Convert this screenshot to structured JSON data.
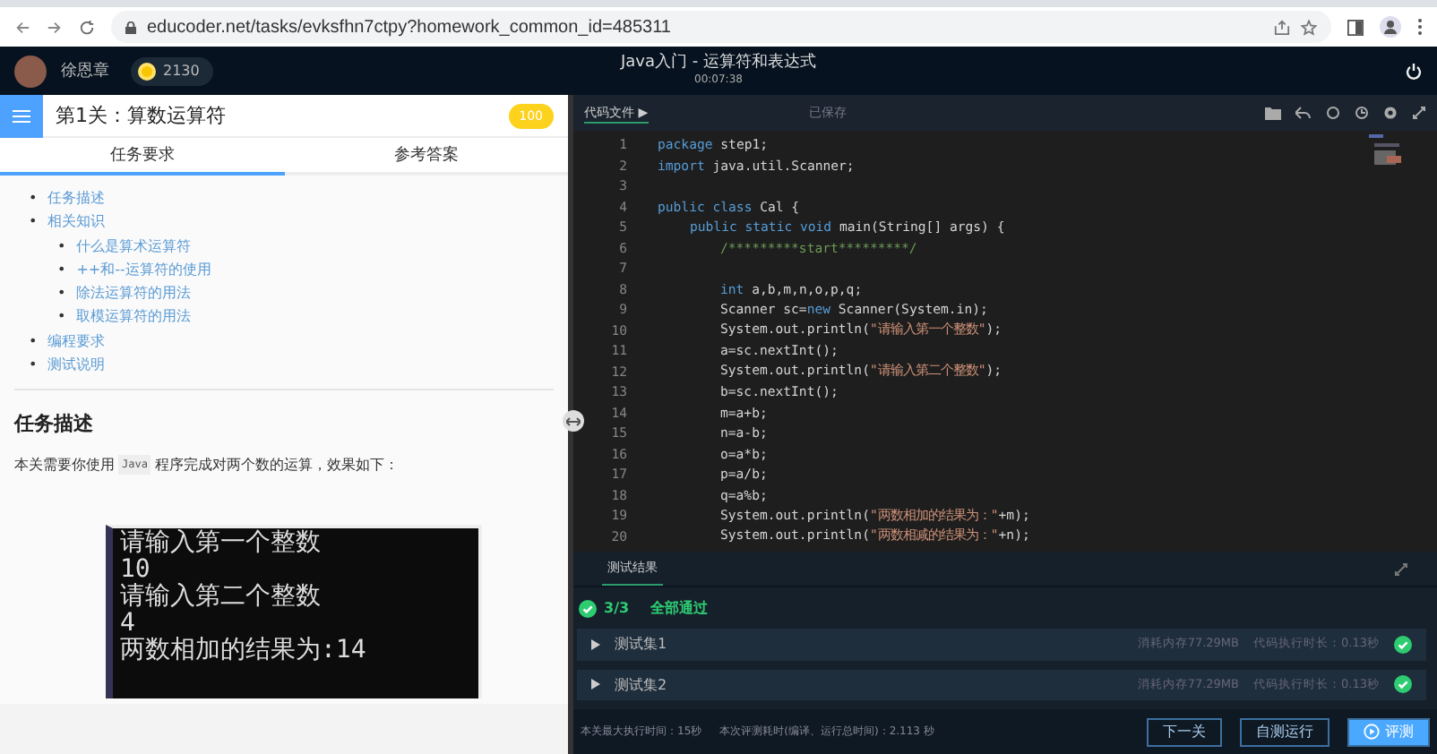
{
  "browser": {
    "url": "educoder.net/tasks/evksfhn7ctpy?homework_common_id=485311"
  },
  "header": {
    "user": "徐恩章",
    "coins": "2130",
    "title": "Java入门 - 运算符和表达式",
    "timer": "00:07:38"
  },
  "task": {
    "title": "第1关：算数运算符",
    "score": "100",
    "tabs": [
      {
        "label": "任务要求",
        "selected": true
      },
      {
        "label": "参考答案",
        "selected": false
      }
    ],
    "toc": [
      {
        "marker": "•",
        "label": "任务描述"
      },
      {
        "marker": "•",
        "label": "相关知识",
        "children": [
          {
            "marker": "•",
            "label": "什么是算术运算符"
          },
          {
            "marker": "•",
            "label": "++和--运算符的使用"
          },
          {
            "marker": "•",
            "label": "除法运算符的用法"
          },
          {
            "marker": "•",
            "label": "取模运算符的用法"
          }
        ]
      },
      {
        "marker": "•",
        "label": "编程要求"
      },
      {
        "marker": "•",
        "label": "测试说明"
      }
    ],
    "heading": "任务描述",
    "intro_before": "本关需要你使用",
    "intro_code": "Java",
    "intro_after": "程序完成对两个数的运算，效果如下：",
    "console": [
      "请输入第一个整数",
      "10",
      "请输入第二个整数",
      "4",
      "两数相加的结果为:14"
    ]
  },
  "editor": {
    "file_tab": "代码文件 ▶",
    "save_status": "已保存",
    "lines": [
      {
        "number": "1",
        "kind": "top",
        "tokens": [
          {
            "t": "package",
            "kind": "keyword"
          },
          {
            "t": " step1;",
            "kind": "plain"
          }
        ]
      },
      {
        "number": "2",
        "kind": "top",
        "tokens": [
          {
            "t": "import",
            "kind": "keyword"
          },
          {
            "t": " java.util.Scanner;",
            "kind": "plain"
          }
        ]
      },
      {
        "number": "3"
      },
      {
        "number": "4",
        "kind": "top",
        "tokens": [
          {
            "t": "public class",
            "kind": "keyword"
          },
          {
            "t": " Cal {",
            "kind": "plain"
          }
        ]
      },
      {
        "number": "5",
        "kind": "member",
        "tokens": [
          {
            "t": "public static void",
            "kind": "keyword"
          },
          {
            "t": " main(String[] args) {",
            "kind": "plain"
          }
        ]
      },
      {
        "number": "6",
        "kind": "body",
        "tokens": [
          {
            "t": "/*********start*********/",
            "kind": "comment"
          }
        ]
      },
      {
        "number": "7"
      },
      {
        "number": "8",
        "kind": "body",
        "tokens": [
          {
            "t": "int",
            "kind": "keyword"
          },
          {
            "t": " a,b,m,n,o,p,q;",
            "kind": "plain"
          }
        ]
      },
      {
        "number": "9",
        "kind": "body",
        "tokens": [
          {
            "t": "Scanner sc=",
            "kind": "plain"
          },
          {
            "t": "new",
            "kind": "keyword"
          },
          {
            "t": " Scanner(System.in);",
            "kind": "plain"
          }
        ]
      },
      {
        "number": "10",
        "kind": "body",
        "tokens": [
          {
            "t": "System.out.println(",
            "kind": "plain"
          },
          {
            "t": "\"请输入第一个整数\"",
            "kind": "string"
          },
          {
            "t": ");",
            "kind": "plain"
          }
        ]
      },
      {
        "number": "11",
        "kind": "body",
        "tokens": [
          {
            "t": "a=sc.nextInt();",
            "kind": "plain"
          }
        ]
      },
      {
        "number": "12",
        "kind": "body",
        "tokens": [
          {
            "t": "System.out.println(",
            "kind": "plain"
          },
          {
            "t": "\"请输入第二个整数\"",
            "kind": "string"
          },
          {
            "t": ");",
            "kind": "plain"
          }
        ]
      },
      {
        "number": "13",
        "kind": "body",
        "tokens": [
          {
            "t": "b=sc.nextInt();",
            "kind": "plain"
          }
        ]
      },
      {
        "number": "14",
        "kind": "body",
        "tokens": [
          {
            "t": "m=a+b;",
            "kind": "plain"
          }
        ]
      },
      {
        "number": "15",
        "kind": "body",
        "tokens": [
          {
            "t": "n=a-b;",
            "kind": "plain"
          }
        ]
      },
      {
        "number": "16",
        "kind": "body",
        "tokens": [
          {
            "t": "o=a*b;",
            "kind": "plain"
          }
        ]
      },
      {
        "number": "17",
        "kind": "body",
        "tokens": [
          {
            "t": "p=a/b;",
            "kind": "plain"
          }
        ]
      },
      {
        "number": "18",
        "kind": "body",
        "tokens": [
          {
            "t": "q=a%b;",
            "kind": "plain"
          }
        ]
      },
      {
        "number": "19",
        "kind": "body",
        "tokens": [
          {
            "t": "System.out.println(",
            "kind": "plain"
          },
          {
            "t": "\"两数相加的结果为：\"",
            "kind": "string"
          },
          {
            "t": "+m);",
            "kind": "plain"
          }
        ]
      },
      {
        "number": "20",
        "kind": "body",
        "tokens": [
          {
            "t": "System.out.println(",
            "kind": "plain"
          },
          {
            "t": "\"两数相减的结果为：\"",
            "kind": "string"
          },
          {
            "t": "+n);",
            "kind": "plain"
          }
        ]
      }
    ]
  },
  "results": {
    "tab": "测试结果",
    "count": "3/3",
    "summary": "全部通过",
    "cases": [
      {
        "name": "测试集1",
        "memory": "消耗内存77.29MB",
        "time": "代码执行时长：0.13秒",
        "passed": true
      },
      {
        "name": "测试集2",
        "memory": "消耗内存77.29MB",
        "time": "代码执行时长：0.13秒",
        "passed": true
      }
    ]
  },
  "footer": {
    "max_time": "本关最大执行时间：15秒",
    "elapsed": "本次评测耗时(编译、运行总时间)：2.113 秒",
    "buttons": [
      {
        "label": "下一关",
        "kind": "outline"
      },
      {
        "label": "自测运行",
        "kind": "outline"
      },
      {
        "label": "评测",
        "kind": "primary"
      }
    ]
  }
}
